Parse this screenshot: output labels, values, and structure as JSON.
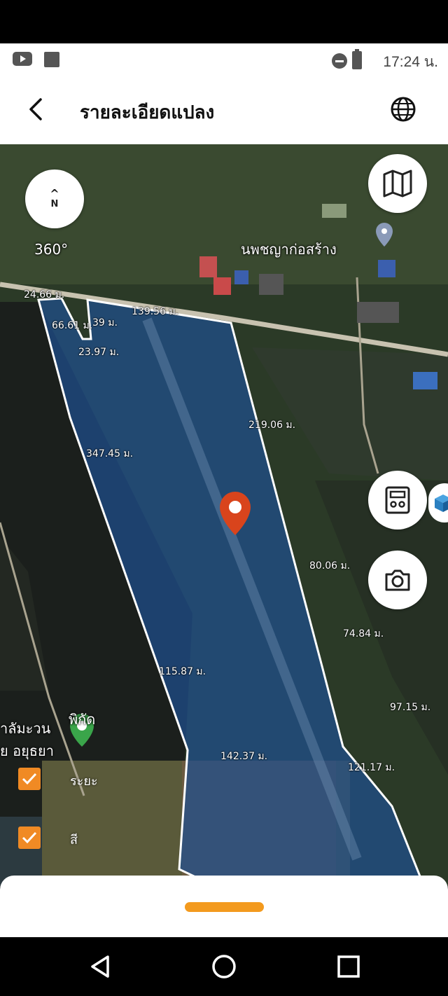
{
  "status_bar": {
    "time": "17:24 น.",
    "icons": [
      "youtube-icon",
      "square-notification-icon",
      "do-not-disturb-icon",
      "battery-charging-icon"
    ]
  },
  "header": {
    "title": "รายละเอียดแปลง",
    "back_icon": "chevron-left-icon",
    "globe_icon": "globe-icon"
  },
  "map": {
    "compass": {
      "arrow": "^",
      "label": "N",
      "rotation_label": "360°"
    },
    "place_name": "นพชญาก่อสร้าง",
    "measurements": [
      "24.66 ม.",
      "66.61 ม.",
      "39 ม.",
      "139.56 ม.",
      "23.97 ม.",
      "219.06 ม.",
      "347.45 ม.",
      "80.06 ม.",
      "74.84 ม.",
      "115.87 ม.",
      "97.15 ม.",
      "142.37 ม.",
      "121.17 ม."
    ],
    "partial_labels": [
      "าลัมะวน",
      "ย อยุธยา",
      "พิกัด",
      "ระยะ",
      "สี"
    ],
    "parcel_color": "#1e4f8f",
    "pin_color": "#d9441c"
  },
  "bottom_sheet": {
    "handle_color": "#f39a1e"
  },
  "nav_bar": {
    "icons": [
      "back-triangle-icon",
      "home-circle-icon",
      "recents-square-icon"
    ]
  }
}
